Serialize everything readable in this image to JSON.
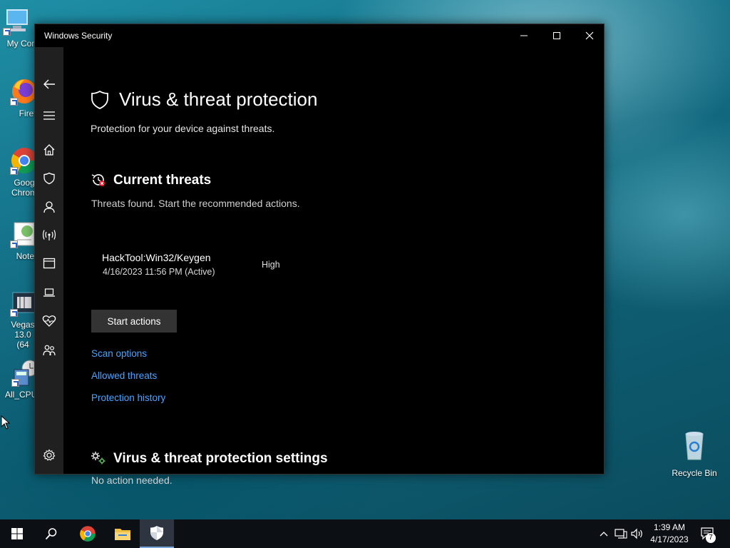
{
  "desktop": {
    "icons": [
      {
        "label": "My Com"
      },
      {
        "label": "Firefo"
      },
      {
        "label": "Goog Chrom"
      },
      {
        "label": "Notepa"
      },
      {
        "label": "Vegas 13.0 (64"
      },
      {
        "label": "All_CPU_"
      },
      {
        "label": "Recycle Bin"
      }
    ]
  },
  "window": {
    "title": "Windows Security",
    "page_title": "Virus & threat protection",
    "subtitle": "Protection for your device against threats.",
    "current_threats": {
      "heading": "Current threats",
      "description": "Threats found. Start the recommended actions.",
      "threat": {
        "name": "HackTool:Win32/Keygen",
        "date": "4/16/2023 11:56 PM (Active)",
        "severity": "High"
      },
      "start_actions_label": "Start actions",
      "links": [
        "Scan options",
        "Allowed threats",
        "Protection history"
      ]
    },
    "settings": {
      "heading": "Virus & threat protection settings",
      "description": "No action needed."
    }
  },
  "taskbar": {
    "time": "1:39 AM",
    "date": "4/17/2023",
    "notification_count": "7"
  },
  "colors": {
    "accent_link": "#4ca3ff",
    "window_bg": "#000000",
    "sidebar_bg": "#202020"
  }
}
